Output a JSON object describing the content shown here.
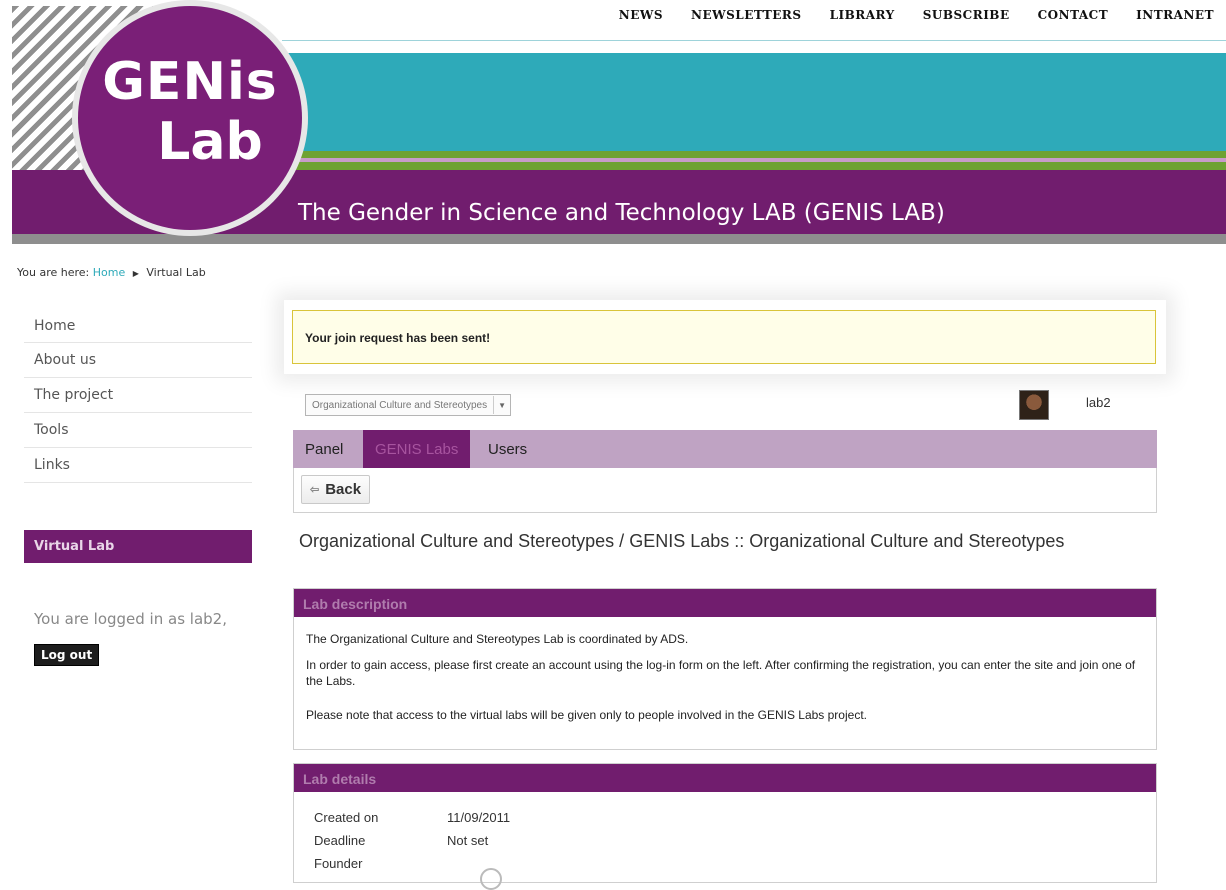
{
  "header": {
    "logo_line1": "GENis",
    "logo_line2": "Lab",
    "site_title": "The Gender in Science and Technology LAB (GENIS LAB)",
    "topnav": [
      "NEWS",
      "NEWSLETTERS",
      "LIBRARY",
      "SUBSCRIBE",
      "CONTACT",
      "INTRANET"
    ]
  },
  "breadcrumb": {
    "prefix": "You are here:",
    "home": "Home",
    "separator": "▶",
    "current": "Virtual Lab"
  },
  "sidebar": {
    "items": [
      "Home",
      "About us",
      "The project",
      "Tools",
      "Links"
    ],
    "section_title": "Virtual Lab",
    "logged_in_text": "You are logged in as lab2,",
    "logout_label": "Log out"
  },
  "notice": "Your join request has been sent!",
  "lab_select": {
    "value": "Organizational Culture and Stereotypes"
  },
  "user": {
    "name": "lab2"
  },
  "tabs": [
    {
      "label": "Panel",
      "active": false
    },
    {
      "label": "GENIS Labs",
      "active": true
    },
    {
      "label": "Users",
      "active": false
    }
  ],
  "toolbar": {
    "back_label": "Back"
  },
  "page_heading": "Organizational Culture and Stereotypes / GENIS Labs :: Organizational Culture and Stereotypes",
  "description": {
    "title": "Lab description",
    "paragraphs": [
      "The Organizational Culture and Stereotypes Lab is coordinated by ADS.",
      "In order to gain access, please first create an account using the log-in form on the left. After confirming the registration, you can enter the site and join one of the Labs.",
      "Please note that access to the virtual labs will be given only to people involved in the GENIS Labs project."
    ]
  },
  "details": {
    "title": "Lab details",
    "rows": [
      {
        "label": "Created on",
        "value": "11/09/2011"
      },
      {
        "label": "Deadline",
        "value": "Not set"
      },
      {
        "label": "Founder",
        "value": ""
      }
    ]
  },
  "colors": {
    "brand_purple": "#711d6e",
    "teal": "#2eaab9",
    "green": "#6ea232",
    "tab_bar": "#bfa3c3"
  }
}
